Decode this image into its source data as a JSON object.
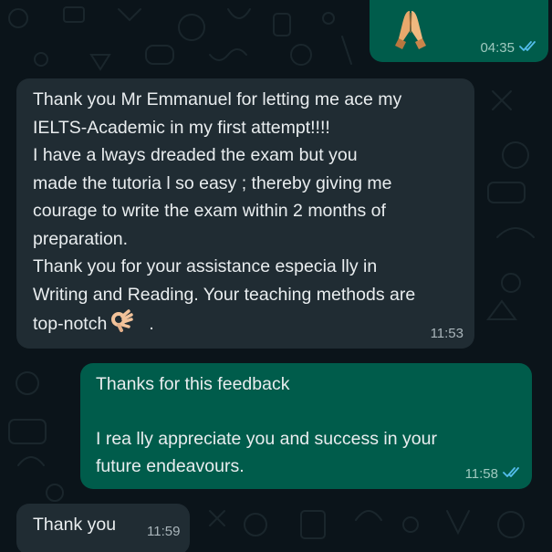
{
  "conversation": {
    "messages": [
      {
        "direction": "outgoing",
        "emoji": "folded-hands-emoji",
        "time": "04:35",
        "status": "read"
      },
      {
        "direction": "incoming",
        "lines": [
          "Thank you Mr Emmanuel for letting me ace my",
          "IELTS-Academic in my first attempt!!!!",
          "I have a lways dreaded the exam but you",
          "made the tutoria l so easy ; thereby giving me",
          "courage to write the exam within 2 months of",
          "preparation.",
          "Thank you for your assistance especia lly in",
          "Writing and Reading. Your teaching methods are",
          "top-notch"
        ],
        "trailing": ".",
        "trailing_emoji": "ok-hand-emoji",
        "time": "11:53"
      },
      {
        "direction": "outgoing",
        "lines": [
          "Thanks for this feedback",
          "",
          "I rea lly appreciate you and success in your",
          "future endeavours."
        ],
        "time": "11:58",
        "status": "read"
      },
      {
        "direction": "incoming",
        "lines": [
          "Thank you"
        ],
        "time": "11:59"
      }
    ]
  },
  "colors": {
    "background": "#0b141a",
    "incoming_bubble": "#202c33",
    "outgoing_bubble": "#005c4b",
    "read_tick": "#53bdeb"
  }
}
